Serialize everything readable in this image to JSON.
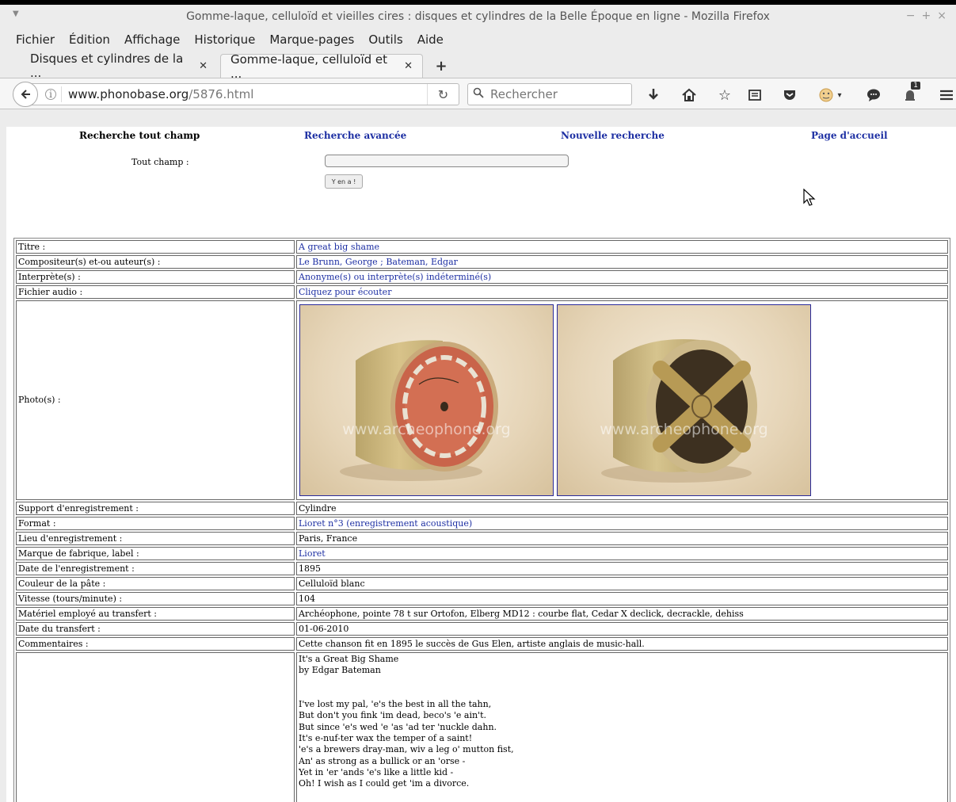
{
  "window": {
    "title": "Gomme-laque, celluloïd et vieilles cires : disques et cylindres de la Belle Époque en ligne - Mozilla Firefox"
  },
  "menu": [
    "Fichier",
    "Édition",
    "Affichage",
    "Historique",
    "Marque-pages",
    "Outils",
    "Aide"
  ],
  "tabs": [
    {
      "label": "Disques et cylindres de la ...",
      "active": false
    },
    {
      "label": "Gomme-laque, celluloïd et ...",
      "active": true
    }
  ],
  "navbar": {
    "url_domain": "www.phonobase.org",
    "url_path": "/5876.html",
    "search_placeholder": "Rechercher",
    "notification_count": "1"
  },
  "page": {
    "nav": {
      "search_all": "Recherche tout champ",
      "advanced": "Recherche avancée",
      "new_search": "Nouvelle recherche",
      "home": "Page d'accueil"
    },
    "search_label": "Tout champ :",
    "go_button": "Y en a !",
    "watermark": "www.archeophone.org",
    "rows": [
      {
        "label": "Titre :",
        "value": "A great big shame",
        "link": true
      },
      {
        "label": "Compositeur(s) et-ou auteur(s) :",
        "value": "Le Brunn, George ; Bateman, Edgar",
        "link": true
      },
      {
        "label": "Interprète(s) :",
        "value": "Anonyme(s) ou interprète(s) indéterminé(s)",
        "link": true
      },
      {
        "label": "Fichier audio :",
        "value": "Cliquez pour écouter",
        "link": true
      }
    ],
    "photo_label": "Photo(s) :",
    "rows2": [
      {
        "label": "Support d'enregistrement :",
        "value": "Cylindre",
        "link": false
      },
      {
        "label": "Format :",
        "value": "Lioret n°3 (enregistrement acoustique)",
        "link": true
      },
      {
        "label": "Lieu d'enregistrement :",
        "value": "Paris, France",
        "link": false
      },
      {
        "label": "Marque de fabrique, label :",
        "value": "Lioret",
        "link": true
      },
      {
        "label": "Date de l'enregistrement :",
        "value": "1895",
        "link": false
      },
      {
        "label": "Couleur de la pâte :",
        "value": "Celluloïd blanc",
        "link": false
      },
      {
        "label": "Vitesse (tours/minute) :",
        "value": "104",
        "link": false
      },
      {
        "label": "Matériel employé au transfert :",
        "value": "Archéophone, pointe 78 t sur Ortofon, Elberg MD12 : courbe flat, Cedar X declick, decrackle, dehiss",
        "link": false
      },
      {
        "label": "Date du transfert :",
        "value": "01-06-2010",
        "link": false
      },
      {
        "label": "Commentaires :",
        "value": "Cette chanson fit en 1895 le succès de Gus Elen, artiste anglais de music-hall.",
        "link": false
      }
    ],
    "lyrics": "It's a Great Big Shame\nby Edgar Bateman\n\n\nI've lost my pal, 'e's the best in all the tahn,\nBut don't you fink 'im dead, beco's 'e ain't.\nBut since 'e's wed 'e 'as 'ad ter 'nuckle dahn.\nIt's e-nuf-ter wax the temper of a saint!\n'e's a brewers dray-man, wiv a leg o' mutton fist,\nAn' as strong as a bullick or an 'orse -\nYet in 'er 'ands 'e's like a little kid -\nOh! I wish as I could get 'im a divorce.\n\nCHORUS"
  }
}
